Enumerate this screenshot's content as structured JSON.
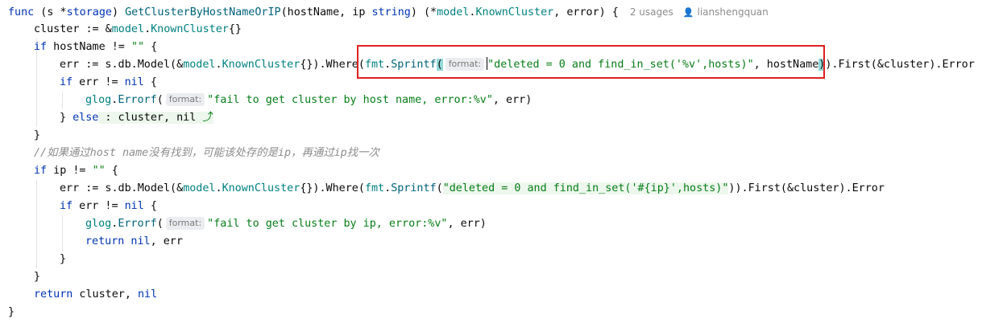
{
  "code": {
    "signature": {
      "kw_func": "func",
      "receiver_open": " (s *",
      "receiver_type": "storage",
      "receiver_close": ") ",
      "func_name": "GetClusterByHostNameOrIP",
      "params": "(hostName, ip ",
      "param_type": "string",
      "params_close": ") (*",
      "pkg": "model",
      "dot": ".",
      "ret_type": "KnownCluster",
      "ret_rest": ", error) {"
    },
    "meta": {
      "usages": "2 usages",
      "author": "lianshengquan"
    },
    "line2": {
      "a": "cluster := &",
      "pkg": "model",
      "dot": ".",
      "type": "KnownCluster",
      "b": "{}"
    },
    "line3": {
      "kw": "if",
      "a": " hostName != ",
      "str": "\"\"",
      "b": " {"
    },
    "line4": {
      "a": "err := s.db.Model(&",
      "pkg": "model",
      "dot": ".",
      "type": "KnownCluster",
      "b": "{}).Where(",
      "pkg2": "fmt",
      "dot2": ".",
      "fn": "Sprintf",
      "paren": "(",
      "hint": "format:",
      "str": "\"deleted = 0 and find_in_set('%v',hosts)\"",
      "c": ", hostName",
      "paren_close": ")",
      "d": ").First(&cluster).Error"
    },
    "line5": {
      "kw": "if",
      "a": " err != ",
      "kw2": "nil",
      "b": " {"
    },
    "line6": {
      "pkg": "glog",
      "dot": ".",
      "fn": "Errorf",
      "paren": "(",
      "hint": "format:",
      "str": "\"fail to get cluster by host name, error:%v\"",
      "b": ", err)"
    },
    "line7": {
      "a": "} ",
      "kw": "else",
      "b": " : cluster, nil ",
      "icon": "⤴"
    },
    "line8": {
      "a": "}"
    },
    "line9": {
      "comment": "//如果通过host name没有找到，可能该处存的是ip，再通过ip找一次"
    },
    "line10": {
      "kw": "if",
      "a": " ip != ",
      "str": "\"\"",
      "b": " {"
    },
    "line11": {
      "a": "err := s.db.Model(&",
      "pkg": "model",
      "dot": ".",
      "type": "KnownCluster",
      "b": "{}).Where(",
      "pkg2": "fmt",
      "dot2": ".",
      "fn": "Sprintf",
      "paren": "(",
      "str": "\"deleted = 0 and find_in_set('#{ip}',hosts)\"",
      "d": ")).First(&cluster).Error"
    },
    "line12": {
      "kw": "if",
      "a": " err != ",
      "kw2": "nil",
      "b": " {"
    },
    "line13": {
      "pkg": "glog",
      "dot": ".",
      "fn": "Errorf",
      "paren": "(",
      "hint": "format:",
      "str": "\"fail to get cluster by ip, error:%v\"",
      "b": ", err)"
    },
    "line14": {
      "kw": "return",
      "kw2": " nil",
      "b": ", err"
    },
    "line15": {
      "a": "}"
    },
    "line16": {
      "a": "}"
    },
    "line17": {
      "kw": "return",
      "a": " cluster, ",
      "kw2": "nil"
    },
    "line18": {
      "a": "}"
    }
  },
  "colors": {
    "keyword": "#0033b3",
    "function": "#00627a",
    "type": "#008080",
    "string": "#067d17",
    "highlight_box": "#e02020"
  }
}
